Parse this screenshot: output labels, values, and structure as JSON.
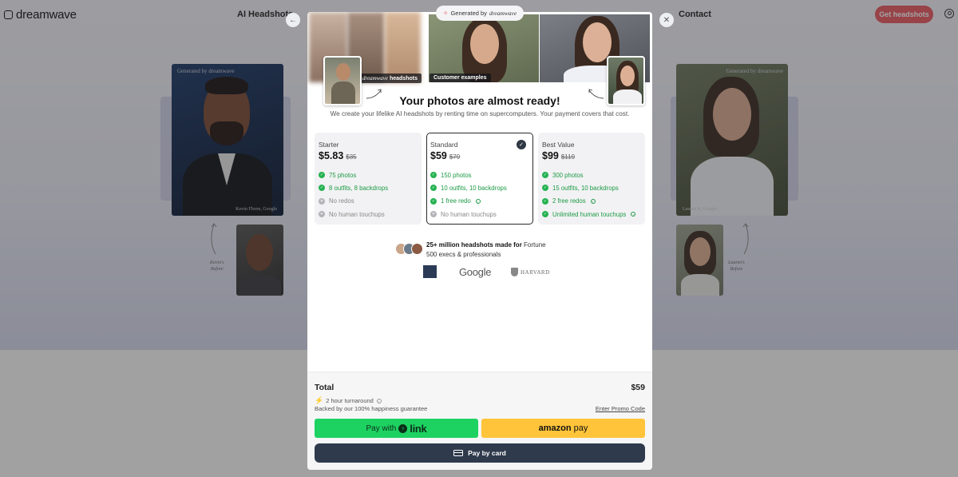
{
  "nav": {
    "brand": "dreamwave",
    "links": {
      "ai_headshots": "AI Headshots",
      "contact": "Contact"
    },
    "cta": "Get headshots"
  },
  "background": {
    "left_card": {
      "generated_tag": "Generated by dreamwave",
      "name": "Kevin Flores, Google",
      "before_note_line1": "Kevin's",
      "before_note_line2": "Before"
    },
    "right_card": {
      "generated_tag": "Generated by dreamwave",
      "name": "Lauren K, Google",
      "before_note_line1": "Lauren's",
      "before_note_line2": "Before"
    }
  },
  "modal": {
    "generated_pill_prefix": "Generated by",
    "generated_pill_brand": "dreamwave",
    "dreamwave_label_brand": "dreamwave",
    "dreamwave_label_suffix": "headshots",
    "customer_label": "Customer examples",
    "title": "Your photos are almost ready!",
    "subtitle": "We create your lifelike AI headshots by renting time on supercomputers. Your payment covers that cost.",
    "plans": [
      {
        "name": "Starter",
        "price": "$5.83",
        "old_price": "$35",
        "features": [
          "75 photos",
          "8 outfits, 8 backdrops",
          "No redos",
          "No human touchups"
        ]
      },
      {
        "name": "Standard",
        "price": "$59",
        "old_price": "$79",
        "features": [
          "150 photos",
          "10 outfits, 10 backdrops",
          "1 free redo",
          "No human touchups"
        ]
      },
      {
        "name": "Best Value",
        "price": "$99",
        "old_price": "$119",
        "features": [
          "300 photos",
          "15 outfits, 10 backdrops",
          "2 free redos",
          "Unlimited human touchups"
        ]
      }
    ],
    "selected_plan": "Standard",
    "proof_bold": "25+ million headshots made for",
    "proof_rest": " Fortune 500 execs & professionals",
    "logos": {
      "google": "Google",
      "harvard": "HARVARD"
    },
    "checkout": {
      "total_label": "Total",
      "total_value": "$59",
      "turnaround": "2 hour turnaround",
      "guarantee": "Backed by our 100% happiness guarantee",
      "promo": "Enter Promo Code",
      "pay_link_prefix": "Pay with",
      "pay_link_word": "link",
      "amazon_brand": "amazon",
      "amazon_pay": "pay",
      "pay_card": "Pay by card"
    }
  },
  "colors": {
    "accent": "#e8595f",
    "check_green": "#25b251",
    "link_green": "#1ed262",
    "amazon_yellow": "#ffc43a",
    "card_button": "#2f3a4c"
  }
}
